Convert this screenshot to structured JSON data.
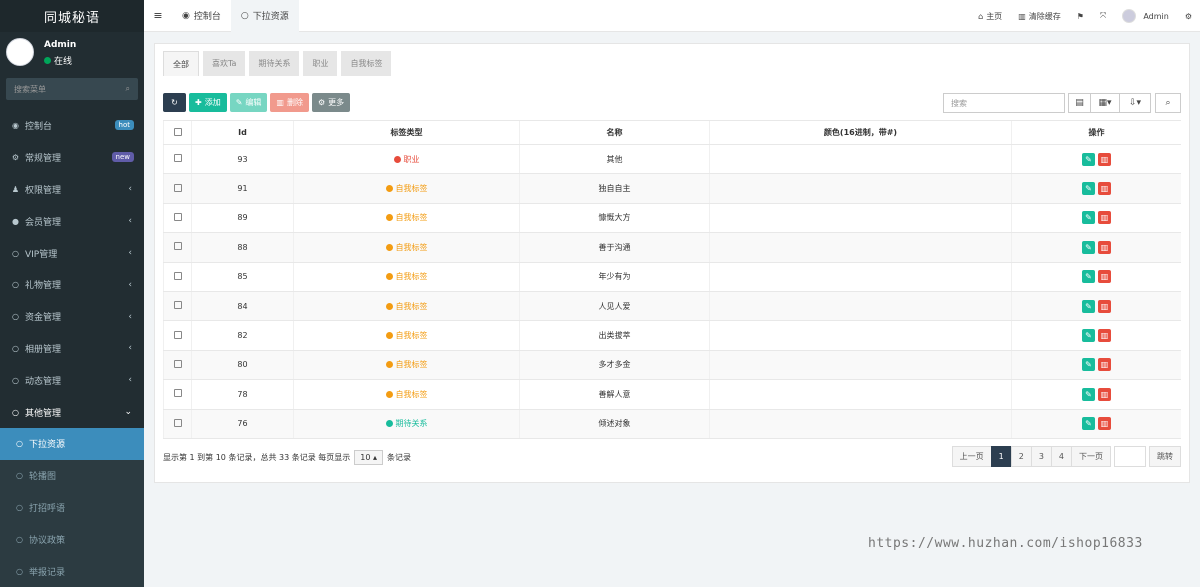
{
  "app": {
    "title": "同城秘语"
  },
  "user": {
    "name": "Admin",
    "status": "在线",
    "status_color": "#00a65a"
  },
  "sidebar": {
    "search_placeholder": "搜索菜单",
    "items": [
      {
        "icon": "dashboard-icon",
        "glyph": "◉",
        "label": "控制台",
        "badge": "hot",
        "badge_color": "#3c8dbc"
      },
      {
        "icon": "cogs-icon",
        "glyph": "⚙",
        "label": "常规管理",
        "badge": "new",
        "badge_color": "#605ca8"
      },
      {
        "icon": "group-icon",
        "glyph": "♟",
        "label": "权限管理",
        "arrow": "‹"
      },
      {
        "icon": "user-circle-icon",
        "glyph": "●",
        "label": "会员管理",
        "arrow": "‹"
      },
      {
        "icon": "circle-icon",
        "glyph": "○",
        "label": "VIP管理",
        "arrow": "‹"
      },
      {
        "icon": "circle-icon",
        "glyph": "○",
        "label": "礼物管理",
        "arrow": "‹"
      },
      {
        "icon": "circle-icon",
        "glyph": "○",
        "label": "资金管理",
        "arrow": "‹"
      },
      {
        "icon": "circle-icon",
        "glyph": "○",
        "label": "相册管理",
        "arrow": "‹"
      },
      {
        "icon": "circle-icon",
        "glyph": "○",
        "label": "动态管理",
        "arrow": "‹"
      },
      {
        "icon": "circle-icon",
        "glyph": "○",
        "label": "其他管理",
        "arrow": "⌄"
      }
    ],
    "subitems": [
      {
        "label": "下拉资源",
        "active": true
      },
      {
        "label": "轮播图"
      },
      {
        "label": "打招呼语"
      },
      {
        "label": "协议政策"
      },
      {
        "label": "举报记录"
      }
    ]
  },
  "topbar": {
    "tabs": [
      {
        "label": "控制台",
        "icon": "dashboard-icon"
      },
      {
        "label": "下拉资源",
        "icon": "circle-icon"
      }
    ],
    "right": [
      {
        "label": "主页",
        "icon": "home-icon",
        "glyph": "⌂"
      },
      {
        "label": "清除缓存",
        "icon": "trash-icon",
        "glyph": "▥"
      },
      {
        "label": "",
        "icon": "translate-icon",
        "glyph": "⚑"
      },
      {
        "label": "",
        "icon": "fullscreen-icon",
        "glyph": "⤧"
      }
    ],
    "admin": "Admin"
  },
  "content": {
    "tabs": [
      "全部",
      "喜欢Ta",
      "期待关系",
      "职业",
      "自我标签"
    ],
    "toolbar": {
      "add": "添加",
      "edit": "编辑",
      "delete": "删除",
      "more": "更多"
    },
    "search_placeholder": "搜索",
    "columns": [
      "Id",
      "标签类型",
      "名称",
      "颜色(16进制，带#)",
      "操作"
    ],
    "rows": [
      {
        "id": "93",
        "type": "职业",
        "type_color": "#e74c3c",
        "name": "其他",
        "color": ""
      },
      {
        "id": "91",
        "type": "自我标签",
        "type_color": "#f39c12",
        "name": "独自自主",
        "color": ""
      },
      {
        "id": "89",
        "type": "自我标签",
        "type_color": "#f39c12",
        "name": "慷慨大方",
        "color": ""
      },
      {
        "id": "88",
        "type": "自我标签",
        "type_color": "#f39c12",
        "name": "善于沟通",
        "color": ""
      },
      {
        "id": "85",
        "type": "自我标签",
        "type_color": "#f39c12",
        "name": "年少有为",
        "color": ""
      },
      {
        "id": "84",
        "type": "自我标签",
        "type_color": "#f39c12",
        "name": "人见人爱",
        "color": ""
      },
      {
        "id": "82",
        "type": "自我标签",
        "type_color": "#f39c12",
        "name": "出类拔萃",
        "color": ""
      },
      {
        "id": "80",
        "type": "自我标签",
        "type_color": "#f39c12",
        "name": "多才多金",
        "color": ""
      },
      {
        "id": "78",
        "type": "自我标签",
        "type_color": "#f39c12",
        "name": "善解人意",
        "color": ""
      },
      {
        "id": "76",
        "type": "期待关系",
        "type_color": "#18bc9c",
        "name": "倾述对象",
        "color": ""
      }
    ],
    "footer": {
      "summary": "显示第 1 到第 10 条记录，总共 33 条记录 每页显示",
      "per_page": "10",
      "suffix": "条记录"
    },
    "pager": {
      "prev": "上一页",
      "pages": [
        "1",
        "2",
        "3",
        "4"
      ],
      "next": "下一页",
      "jump": "跳转"
    }
  },
  "watermark": "https://www.huzhan.com/ishop16833"
}
